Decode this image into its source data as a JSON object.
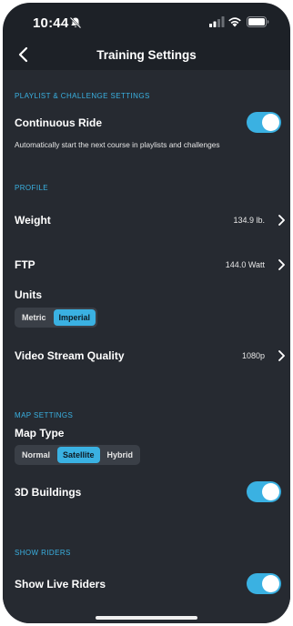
{
  "status_bar": {
    "time": "10:44"
  },
  "nav": {
    "title": "Training Settings"
  },
  "sections": {
    "playlist": "PLAYLIST & CHALLENGE SETTINGS",
    "profile": "PROFILE",
    "map": "MAP SETTINGS",
    "riders": "SHOW RIDERS"
  },
  "continuous_ride": {
    "label": "Continuous Ride",
    "description": "Automatically start the next course in playlists and challenges",
    "enabled": true
  },
  "weight": {
    "label": "Weight",
    "value": "134.9 lb."
  },
  "ftp": {
    "label": "FTP",
    "value": "144.0 Watt"
  },
  "units": {
    "label": "Units",
    "options": [
      "Metric",
      "Imperial"
    ],
    "selected": "Imperial"
  },
  "video_quality": {
    "label": "Video Stream Quality",
    "value": "1080p"
  },
  "map_type": {
    "label": "Map Type",
    "options": [
      "Normal",
      "Satellite",
      "Hybrid"
    ],
    "selected": "Satellite"
  },
  "buildings_3d": {
    "label": "3D Buildings",
    "enabled": true
  },
  "live_riders": {
    "label": "Show Live Riders",
    "enabled": true
  },
  "colors": {
    "accent": "#3ab1e2",
    "background": "#262a31",
    "header": "#1d2127"
  }
}
